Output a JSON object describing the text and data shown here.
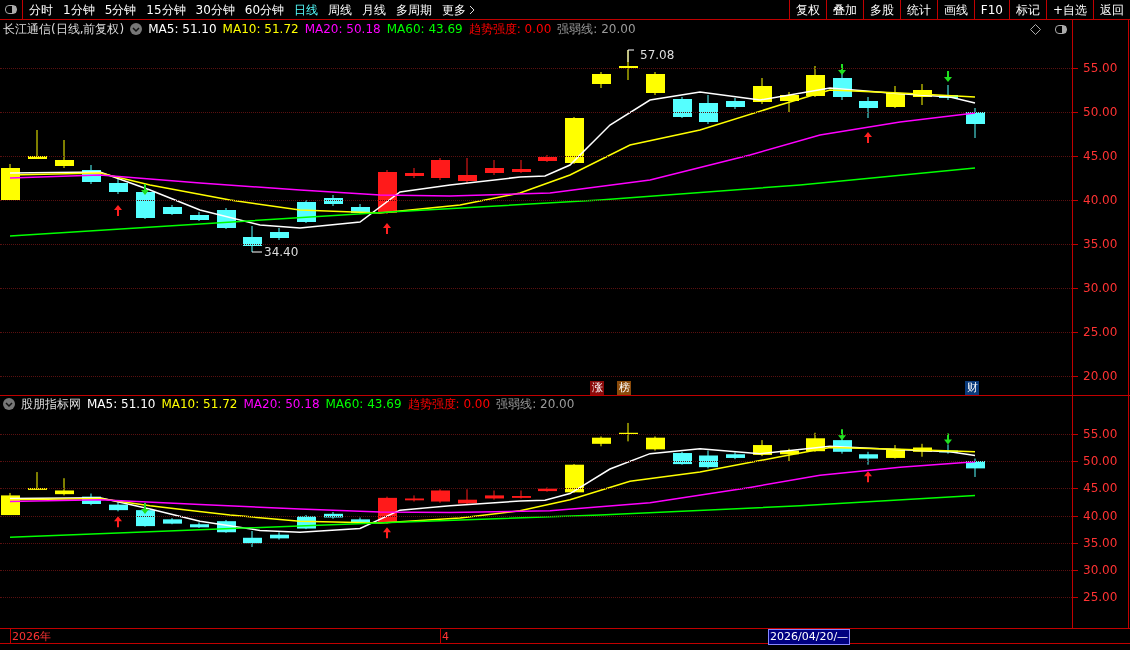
{
  "toolbar": {
    "periods": [
      {
        "label": "分时",
        "selected": false
      },
      {
        "label": "1分钟",
        "selected": false
      },
      {
        "label": "5分钟",
        "selected": false
      },
      {
        "label": "15分钟",
        "selected": false
      },
      {
        "label": "30分钟",
        "selected": false
      },
      {
        "label": "60分钟",
        "selected": false
      },
      {
        "label": "日线",
        "selected": true
      },
      {
        "label": "周线",
        "selected": false
      },
      {
        "label": "月线",
        "selected": false
      },
      {
        "label": "多周期",
        "selected": false
      },
      {
        "label": "更多",
        "selected": false
      }
    ],
    "actions": [
      "复权",
      "叠加",
      "多股",
      "统计",
      "画线",
      "F10",
      "标记",
      "+自选",
      "返回"
    ]
  },
  "main_panel": {
    "title": "长江通信(日线,前复权)",
    "indicators": [
      {
        "label": "MA5: 51.10",
        "color": "#ffffff"
      },
      {
        "label": "MA10: 51.72",
        "color": "#ffff00"
      },
      {
        "label": "MA20: 50.18",
        "color": "#ff00ff"
      },
      {
        "label": "MA60: 43.69",
        "color": "#00ff00"
      },
      {
        "label": "趋势强度: 0.00",
        "color": "#ff0000"
      },
      {
        "label": "强弱线: 20.00",
        "color": "#9a9a9a"
      }
    ],
    "high_label": "57.08",
    "low_label": "34.40",
    "axis": [
      "55.00",
      "50.00",
      "45.00",
      "40.00",
      "35.00",
      "30.00",
      "25.00",
      "20.00"
    ],
    "badges": [
      {
        "text": "涨",
        "color": "#8b0a0a"
      },
      {
        "text": "榜",
        "color": "#8a4a0a"
      },
      {
        "text": "财",
        "color": "#0a3a7a"
      }
    ]
  },
  "lower_panel": {
    "title": "股朋指标网",
    "indicators": [
      {
        "label": "MA5: 51.10",
        "color": "#ffffff"
      },
      {
        "label": "MA10: 51.72",
        "color": "#ffff00"
      },
      {
        "label": "MA20: 50.18",
        "color": "#ff00ff"
      },
      {
        "label": "MA60: 43.69",
        "color": "#00ff00"
      },
      {
        "label": "趋势强度: 0.00",
        "color": "#ff0000"
      },
      {
        "label": "强弱线: 20.00",
        "color": "#9a9a9a"
      }
    ],
    "axis": [
      "55.00",
      "50.00",
      "45.00",
      "40.00",
      "35.00",
      "30.00",
      "25.00"
    ]
  },
  "date_bar": {
    "labels": [
      "2026年",
      "4"
    ],
    "cursor": "2026/04/20/—"
  }
}
